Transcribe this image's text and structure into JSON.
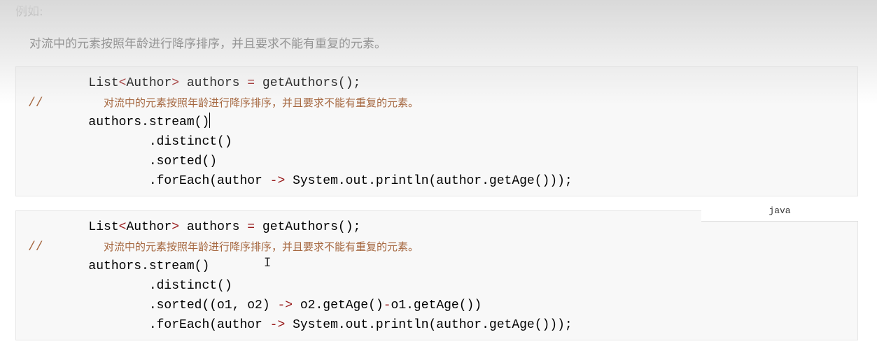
{
  "intro": "例如:",
  "description": "对流中的元素按照年龄进行降序排序，并且要求不能有重复的元素。",
  "language_label": "java",
  "code_blocks": [
    {
      "lines": [
        [
          {
            "t": "        List",
            "c": ""
          },
          {
            "t": "<",
            "c": "op"
          },
          {
            "t": "Author",
            "c": ""
          },
          {
            "t": ">",
            "c": "op"
          },
          {
            "t": " authors ",
            "c": ""
          },
          {
            "t": "=",
            "c": "op"
          },
          {
            "t": " getAuthors();",
            "c": ""
          }
        ],
        [
          {
            "t": "//",
            "c": "cm"
          },
          {
            "t": "        ",
            "c": ""
          },
          {
            "t": "对流中的元素按照年龄进行降序排序，并且要求不能有重复的元素。",
            "c": "cmt"
          }
        ],
        [
          {
            "t": "        authors.stream()",
            "c": ""
          },
          {
            "t": "",
            "c": "caret"
          }
        ],
        [
          {
            "t": "                .distinct()",
            "c": ""
          }
        ],
        [
          {
            "t": "                .sorted()",
            "c": ""
          }
        ],
        [
          {
            "t": "                .forEach(author ",
            "c": ""
          },
          {
            "t": "->",
            "c": "op"
          },
          {
            "t": " System.out.println(author.getAge()));",
            "c": ""
          }
        ]
      ]
    },
    {
      "lines": [
        [
          {
            "t": "        List",
            "c": ""
          },
          {
            "t": "<",
            "c": "op"
          },
          {
            "t": "Author",
            "c": ""
          },
          {
            "t": ">",
            "c": "op"
          },
          {
            "t": " authors ",
            "c": ""
          },
          {
            "t": "=",
            "c": "op"
          },
          {
            "t": " getAuthors();",
            "c": ""
          }
        ],
        [
          {
            "t": "//",
            "c": "cm"
          },
          {
            "t": "        ",
            "c": ""
          },
          {
            "t": "对流中的元素按照年龄进行降序排序，并且要求不能有重复的元素。",
            "c": "cmt"
          }
        ],
        [
          {
            "t": "        authors.stream()",
            "c": ""
          }
        ],
        [
          {
            "t": "                .distinct()",
            "c": ""
          }
        ],
        [
          {
            "t": "                .sorted((o1, o2) ",
            "c": ""
          },
          {
            "t": "->",
            "c": "op"
          },
          {
            "t": " o2.getAge()",
            "c": ""
          },
          {
            "t": "-",
            "c": "op"
          },
          {
            "t": "o1.getAge())",
            "c": ""
          }
        ],
        [
          {
            "t": "                .forEach(author ",
            "c": ""
          },
          {
            "t": "->",
            "c": "op"
          },
          {
            "t": " System.out.println(author.getAge()));",
            "c": ""
          }
        ]
      ]
    }
  ],
  "colors": {
    "operator": "#981a1a",
    "comment": "#a5663e",
    "code_bg": "#f8f8f8"
  }
}
